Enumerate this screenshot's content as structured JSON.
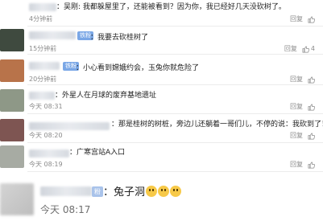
{
  "comments": [
    {
      "text": "：吴刚: 我都躲屋里了，还能被看到？因为你，我已经好几天没砍树了。",
      "time": "4分钟前",
      "reply": "回复",
      "likes": "",
      "avatar_color": "#9aa39b"
    },
    {
      "badge": "铁粉",
      "text": "：我要去砍桂树了",
      "time": "15分钟前",
      "reply": "回复",
      "likes": "4",
      "avatar_color": "#3f4a3f"
    },
    {
      "badge": "铁粉",
      "text": "：小心看到嫦娥约会，玉兔你就危险了",
      "time": "20分钟前",
      "reply": "回复",
      "likes": "",
      "avatar_color": "#b8734a"
    },
    {
      "text": "：外星人在月球的废弃基地遗址",
      "time": "今天 08:31",
      "reply": "回复",
      "likes": "",
      "avatar_color": "#8e9887"
    },
    {
      "text": "：那是桂树的树桩，旁边儿还躺着一哥们儿，不停的说：我砍到了！",
      "time": "今天 08:20",
      "reply": "回复",
      "likes": "",
      "avatar_color": "#7e5552"
    },
    {
      "text": "：广寒宫站A入口",
      "time": "今天 08:19",
      "reply": "回复",
      "likes": "",
      "avatar_color": "#a7aba3"
    },
    {
      "badge": "粉",
      "text": "：兔子洞",
      "time": "今天 08:17",
      "avatar_color": "#c9c9c9"
    }
  ],
  "colors": {
    "accent": "#7aa7e6",
    "muted": "#8a8a8a"
  },
  "icons": {
    "reply": "reply-icon",
    "like": "thumbs-up-icon"
  }
}
